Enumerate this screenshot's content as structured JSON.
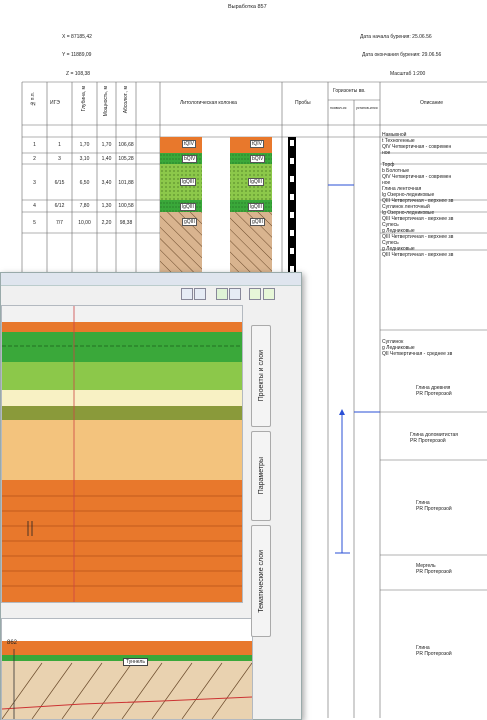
{
  "header": {
    "title": "Выработка 857",
    "x_coord": "X = 87185,42",
    "y_coord": "Y = 11889,09",
    "z_coord": "Z = 108,38",
    "start_date": "Дата начала бурения: 25.06.56",
    "end_date": "Дата окончания бурения: 29.06.56",
    "scale": "Масштаб 1:200"
  },
  "columns": {
    "layer_no": "№п.п.",
    "igl": "ИГЭ",
    "depth": "Глубина, м",
    "thickness": "Мощность, м",
    "abs_mark": "Абсолют., м",
    "litho": "Литологическая колонка",
    "samples": "Пробы",
    "water": "Горизонты вв.",
    "water_appear": "появил-ся",
    "water_set": "установ-ился",
    "description": "Описание"
  },
  "layers": [
    {
      "no": "1",
      "ige": "1",
      "depth": "1,70",
      "thick": "1,70",
      "abs": "106,68",
      "code": "tQIV"
    },
    {
      "no": "2",
      "ige": "3",
      "depth": "3,10",
      "thick": "1,40",
      "abs": "105,28",
      "code": "bQIV"
    },
    {
      "no": "3",
      "ige": "6/15",
      "depth": "6,50",
      "thick": "3,40",
      "abs": "101,88",
      "code": "lgQIII"
    },
    {
      "no": "4",
      "ige": "6/12",
      "depth": "7,80",
      "thick": "1,30",
      "abs": "100,58",
      "code": "lgQIII"
    },
    {
      "no": "5",
      "ige": "7/7",
      "depth": "10,00",
      "thick": "2,20",
      "abs": "98,38",
      "code": "gQIII"
    }
  ],
  "descriptions": [
    {
      "lines": [
        "Намывной",
        "t Техногенные",
        "QIV Четвертичная - современ",
        "ное"
      ]
    },
    {
      "lines": [
        "Торф",
        "b Болотные",
        "QIV Четвертичная - современ",
        "ное"
      ]
    },
    {
      "lines": [
        "Глина ленточная",
        "lg Озерно-ледниковые",
        "QIII Четвертичная - верхнее зв"
      ]
    },
    {
      "lines": [
        "Суглинок ленточный",
        "lg Озерно-ледниковые",
        "QIII Четвертичная - верхнее зв"
      ]
    },
    {
      "lines": [
        "Супесь",
        "g Ледниковые",
        "QIII Четвертичная - верхнее зв"
      ]
    },
    {
      "lines": [
        "Супесь",
        "g Ледниковые",
        "QIII Четвертичная - верхнее зв"
      ]
    },
    {
      "lines": [
        "Суглинок",
        "g Ледниковые",
        "QII Четвертичная - среднее зв"
      ]
    },
    {
      "lines": [
        "Глина древняя",
        "PR Протерозой"
      ]
    },
    {
      "lines": [
        "Глина доломитистая",
        "PR Протерозой"
      ]
    },
    {
      "lines": [
        "Глина",
        "PR Протерозой"
      ]
    },
    {
      "lines": [
        "Мергель",
        "PR Протерозой"
      ]
    },
    {
      "lines": [
        "Глина",
        "PR Протерозой"
      ]
    }
  ],
  "window": {
    "tabs": [
      "Проекты и слои",
      "Параметры",
      "Тематические слои"
    ],
    "coord_label": "862",
    "map_label": "Туннель"
  },
  "colors": {
    "orange": "#e8782c",
    "green": "#3aa83a",
    "light_green": "#8cc84a",
    "brown_hatch": "#c9a27a",
    "blue_line": "#2a4fd6"
  }
}
